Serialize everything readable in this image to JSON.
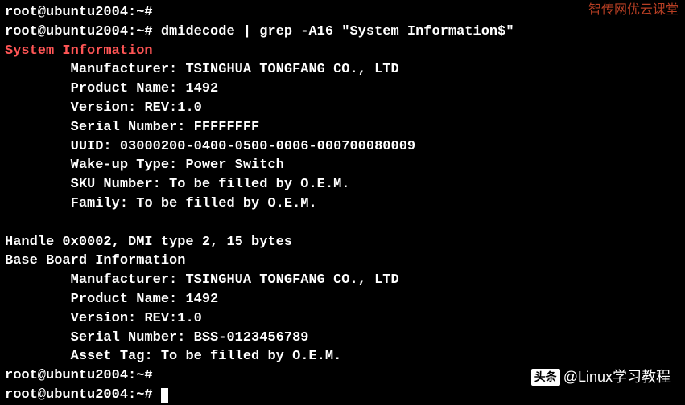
{
  "prompt": "root@ubuntu2004:~#",
  "command": "dmidecode | grep -A16 \"System Information$\"",
  "section_heading": "System Information",
  "system_info": {
    "manufacturer": "Manufacturer: TSINGHUA TONGFANG CO., LTD",
    "product_name": "Product Name: 1492",
    "version": "Version: REV:1.0",
    "serial": "Serial Number: FFFFFFFF",
    "uuid": "UUID: 03000200-0400-0500-0006-000700080009",
    "wakeup": "Wake-up Type: Power Switch",
    "sku": "SKU Number: To be filled by O.E.M.",
    "family": "Family: To be filled by O.E.M."
  },
  "handle_line": "Handle 0x0002, DMI type 2, 15 bytes",
  "baseboard_heading": "Base Board Information",
  "baseboard": {
    "manufacturer": "Manufacturer: TSINGHUA TONGFANG CO., LTD",
    "product_name": "Product Name: 1492",
    "version": "Version: REV:1.0",
    "serial": "Serial Number: BSS-0123456789",
    "asset": "Asset Tag: To be filled by O.E.M."
  },
  "watermarks": {
    "top": "智传网优云课堂",
    "mid": "",
    "bottom_prefix": "头条",
    "bottom_account": "@Linux学习教程"
  }
}
